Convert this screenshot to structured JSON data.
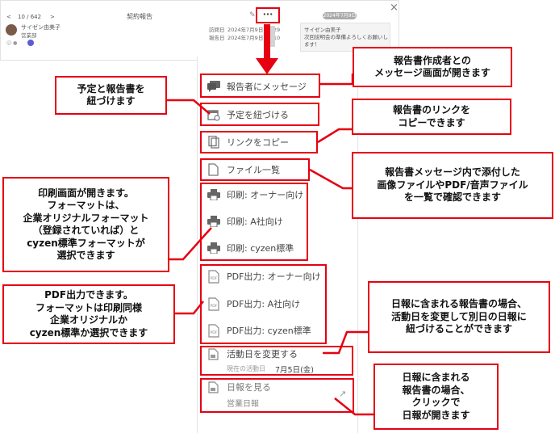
{
  "header": {
    "nav_prev": "<",
    "counter": "10 / 642",
    "nav_next": ">",
    "title": "契約報告",
    "more_button": "···",
    "close": "×"
  },
  "report": {
    "author": "サイゼン由美子",
    "department": "営業部",
    "visit_label": "訪問日",
    "visit_value": "2024年7月9日 10:29",
    "report_label": "報告日",
    "report_value": "2024年7月9日 11:10"
  },
  "side": {
    "date_badge": "2024年7月9日",
    "author": "サイゼン由美子",
    "message": "次回説明会の準備よろしくお願いします！"
  },
  "menu": {
    "message": "報告者にメッセージ",
    "link_schedule": "予定を紐づける",
    "copy_link": "リンクをコピー",
    "file_list": "ファイル一覧",
    "print_owner": "印刷: オーナー向け",
    "print_a": "印刷: A社向け",
    "print_cyzen": "印刷: cyzen標準",
    "pdf_owner": "PDF出力: オーナー向け",
    "pdf_a": "PDF出力: A社向け",
    "pdf_cyzen": "PDF出力: cyzen標準",
    "change_date": "活動日を変更する",
    "current_date_label": "現在の活動日",
    "current_date_value": "7月5日(金)",
    "view_daily": "日報を見る",
    "daily_name": "営業日報"
  },
  "callouts": {
    "message": "報告書作成者との\nメッセージ画面が開きます",
    "schedule": "予定と報告書を\n紐づけます",
    "link": "報告書のリンクを\nコピーできます",
    "files": "報告書メッセージ内で添付した\n画像ファイルやPDF/音声ファイル\nを一覧で確認できます",
    "print": "印刷画面が開きます。\nフォーマットは、\n企業オリジナルフォーマット\n（登録されていれば）と\ncyzen標準フォーマットが\n選択できます",
    "pdf": "PDF出力できます。\nフォーマットは印刷同様\n企業オリジナルか\ncyzen標準か選択できます",
    "change_date": "日報に含まれる報告書の場合、\n活動日を変更して別日の日報に\n紐づけることができます",
    "daily": "日報に含まれる\n報告書の場合、\nクリックで\n日報が開きます"
  },
  "colors": {
    "accent_red": "#e60012",
    "pdf_red": "#d9534f"
  }
}
